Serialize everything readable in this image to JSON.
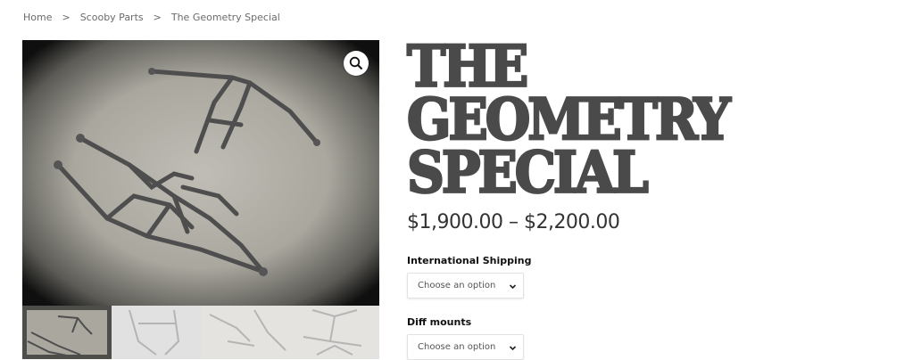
{
  "breadcrumb": {
    "items": [
      "Home",
      "Scooby Parts",
      "The Geometry Special"
    ],
    "separator": ">"
  },
  "gallery": {
    "zoom_icon": "magnifier-icon",
    "thumbnail_count": 4
  },
  "product": {
    "title_lines": [
      "THE",
      "GEOMETRY",
      "SPECIAL"
    ],
    "price_range": "$1,900.00 – $2,200.00"
  },
  "options": [
    {
      "label": "International Shipping",
      "selected": "Choose an option"
    },
    {
      "label": "Diff mounts",
      "selected": "Choose an option"
    }
  ],
  "colors": {
    "title": "#4a4a4a",
    "text": "#333333",
    "breadcrumb": "#6b6b6b"
  }
}
